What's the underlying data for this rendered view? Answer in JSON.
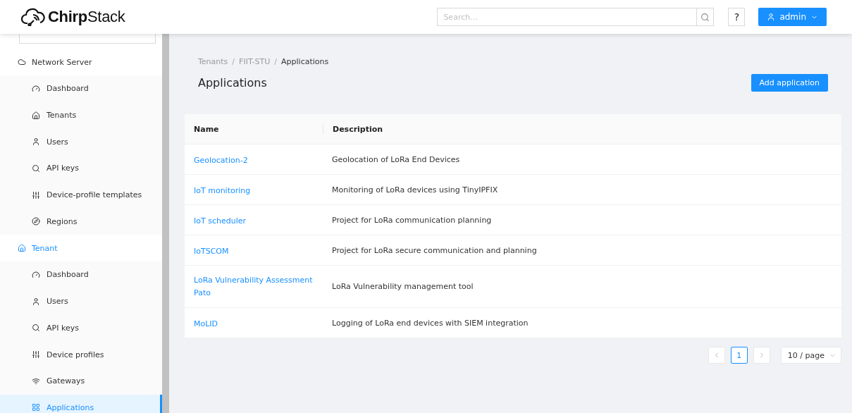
{
  "header": {
    "logo": {
      "text_bold": "Chirp",
      "text_regular": "Stack"
    },
    "search": {
      "placeholder": "Search..."
    },
    "help_label": "?",
    "user_label": "admin"
  },
  "sidebar": {
    "items": [
      {
        "label": "Network Server",
        "selected": false,
        "children": [
          {
            "label": "Dashboard",
            "selected": false
          },
          {
            "label": "Tenants",
            "selected": false
          },
          {
            "label": "Users",
            "selected": false
          },
          {
            "label": "API keys",
            "selected": false
          },
          {
            "label": "Device-profile templates",
            "selected": false
          },
          {
            "label": "Regions",
            "selected": false
          }
        ]
      },
      {
        "label": "Tenant",
        "selected": true,
        "children": [
          {
            "label": "Dashboard",
            "selected": false
          },
          {
            "label": "Users",
            "selected": false
          },
          {
            "label": "API keys",
            "selected": false
          },
          {
            "label": "Device profiles",
            "selected": false
          },
          {
            "label": "Gateways",
            "selected": false
          },
          {
            "label": "Applications",
            "selected": true
          }
        ]
      }
    ]
  },
  "breadcrumb": [
    "Tenants",
    "FIIT-STU",
    "Applications"
  ],
  "breadcrumb_separators": [
    "/",
    "/"
  ],
  "page_title": "Applications",
  "add_button": "Add application",
  "table": {
    "columns": [
      "Name",
      "Description"
    ],
    "rows": [
      {
        "name": "Geolocation-2",
        "description": "Geolocation of LoRa End Devices"
      },
      {
        "name": "IoT monitoring",
        "description": "Monitoring of LoRa devices using TinyIPFIX"
      },
      {
        "name": "IoT scheduler",
        "description": "Project for LoRa communication planning"
      },
      {
        "name": "IoTSCOM",
        "description": "Project for LoRa secure communication and planning"
      },
      {
        "name": "LoRa Vulnerability Assessment Pato",
        "description": "LoRa Vulnerability management tool"
      },
      {
        "name": "MoLID",
        "description": "Logging of LoRa end devices with SIEM integration"
      }
    ]
  },
  "pagination": {
    "pages": [
      {
        "label": "1",
        "selected": true
      }
    ],
    "page_size": "10 / page"
  }
}
